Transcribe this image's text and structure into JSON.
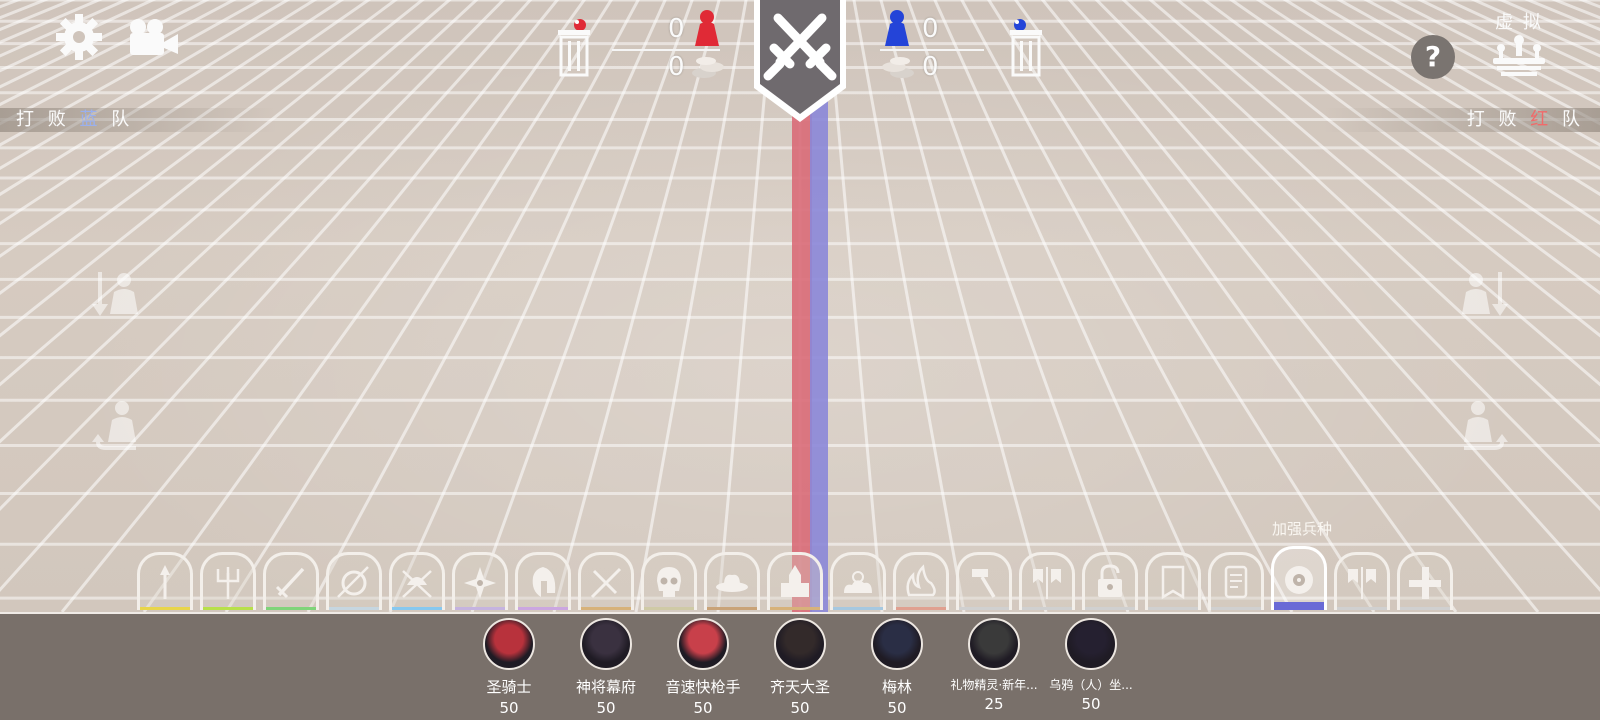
{
  "top": {
    "red_score": "0",
    "red_cost": "0",
    "blue_score": "0",
    "blue_cost": "0",
    "virtual_label": "虚 拟"
  },
  "defeat_left": {
    "prefix": "打 败",
    "team": "蓝",
    "suffix": "队"
  },
  "defeat_right": {
    "prefix": "打 败",
    "team": "红",
    "suffix": "队"
  },
  "upgrade_label": "加强兵种",
  "tabs": [
    {
      "icon": "spear-icon",
      "underline": "#e8d54a"
    },
    {
      "icon": "trident-icon",
      "underline": "#b8e04a"
    },
    {
      "icon": "sword-icon",
      "underline": "#7fd47a"
    },
    {
      "icon": "shield-icon",
      "underline": "#c6d6e0"
    },
    {
      "icon": "viking-icon",
      "underline": "#87c8ef"
    },
    {
      "icon": "shuriken-icon",
      "underline": "#c5b3df"
    },
    {
      "icon": "spartan-helmet-icon",
      "underline": "#cba6e0"
    },
    {
      "icon": "crossed-swords-icon",
      "underline": "#d7b27a"
    },
    {
      "icon": "skull-icon",
      "underline": "#cfcaa6"
    },
    {
      "icon": "cowboy-hat-icon",
      "underline": "#c9a378"
    },
    {
      "icon": "castle-icon",
      "underline": "#d7b27a"
    },
    {
      "icon": "cloud-icon",
      "underline": "#a6c8e0"
    },
    {
      "icon": "fire-icon",
      "underline": "#e0a090"
    },
    {
      "icon": "hammer-icon",
      "underline": "#d0d0d0"
    },
    {
      "icon": "banner-icon",
      "underline": "#d0d0d0"
    },
    {
      "icon": "unlock-icon",
      "underline": "#d0d0d0"
    },
    {
      "icon": "flag-icon",
      "underline": "#d0d0d0"
    },
    {
      "icon": "tablet-icon",
      "underline": "#d0d0d0"
    },
    {
      "icon": "disc-icon",
      "underline": "#6a6ad6",
      "selected": true
    },
    {
      "icon": "banner-icon",
      "underline": "#d0d0d0"
    },
    {
      "icon": "plus-icon",
      "underline": "#d0d0d0"
    }
  ],
  "units": [
    {
      "name": "圣骑士",
      "cost": "50",
      "color": "#b8323c"
    },
    {
      "name": "神将幕府",
      "cost": "50",
      "color": "#3a3140"
    },
    {
      "name": "音速快枪手",
      "cost": "50",
      "color": "#c8404a"
    },
    {
      "name": "齐天大圣",
      "cost": "50",
      "color": "#332a2a"
    },
    {
      "name": "梅林",
      "cost": "50",
      "color": "#2a2e45"
    },
    {
      "name": "礼物精灵·新年...",
      "cost": "25",
      "color": "#3a3a3a",
      "small": true
    },
    {
      "name": "乌鸦（人）坐...",
      "cost": "50",
      "color": "#252030",
      "small": true
    }
  ],
  "colors": {
    "red_team": "#e02a36",
    "blue_team": "#2444d8",
    "selected_tab": "#6a6ad6"
  }
}
